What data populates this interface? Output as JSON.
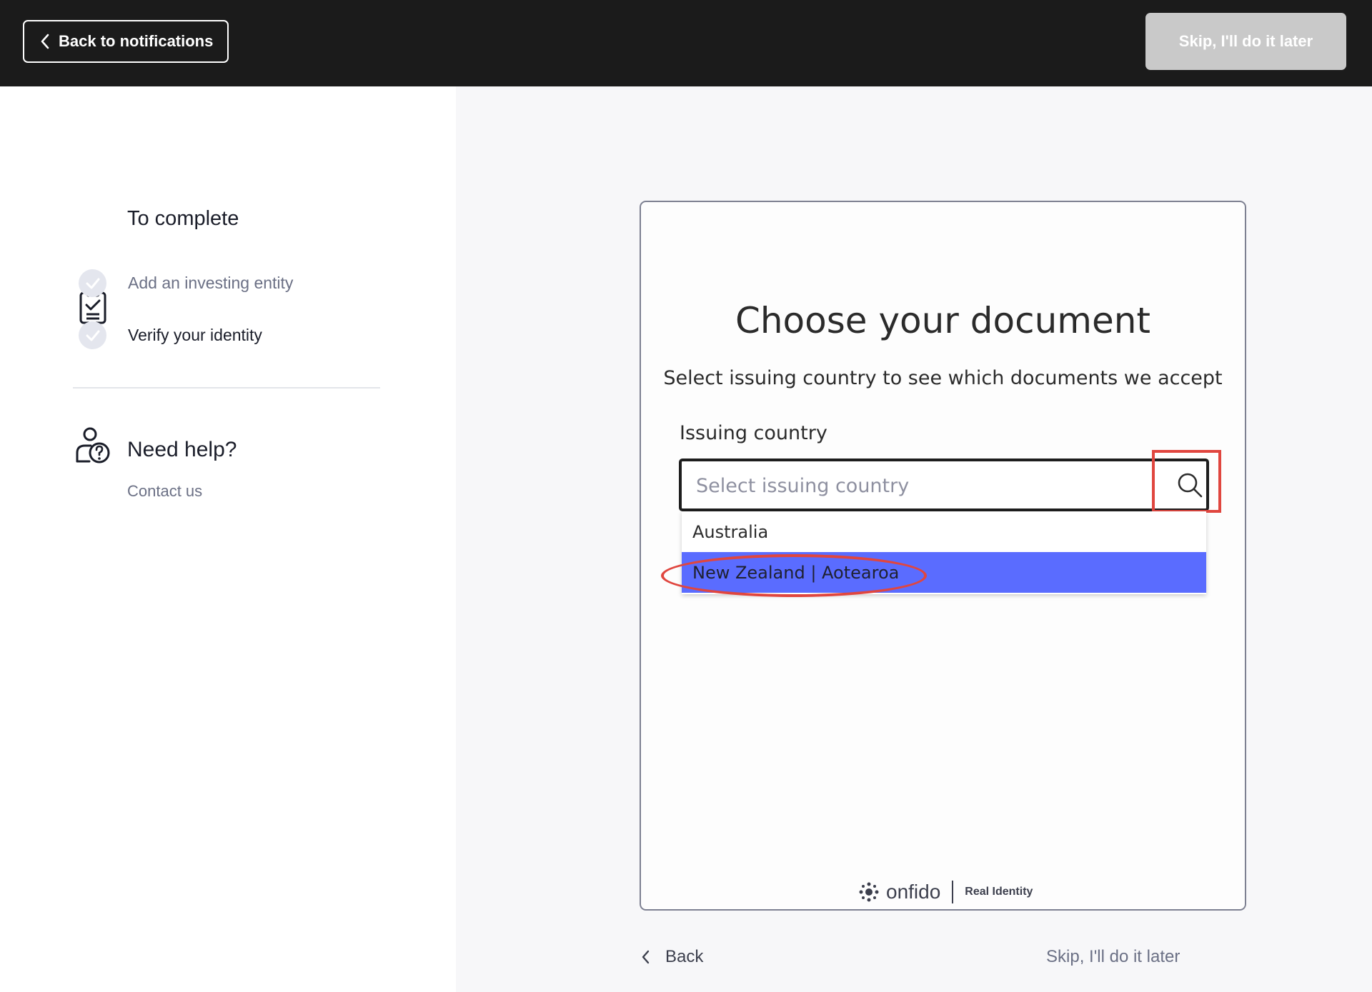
{
  "topbar": {
    "back_label": "Back to notifications",
    "skip_label": "Skip, I'll do it later"
  },
  "sidebar": {
    "todo_title": "To complete",
    "steps": [
      {
        "label": "Add an investing entity"
      },
      {
        "label": "Verify your identity"
      }
    ],
    "help_title": "Need help?",
    "contact_label": "Contact us"
  },
  "card": {
    "title": "Choose your document",
    "subtitle": "Select issuing country to see which documents we accept",
    "field_label": "Issuing country",
    "field_placeholder": "Select issuing country",
    "options": [
      "Australia",
      "New Zealand | Aotearoa"
    ],
    "selected_option": "New Zealand | Aotearoa",
    "brand_name": "onfido",
    "brand_tag": "Real Identity"
  },
  "footer": {
    "back_label": "Back",
    "skip_label": "Skip, I'll do it later"
  },
  "colors": {
    "topbar": "#1b1b1b",
    "accent": "#5a6cff",
    "annotation": "#e0463f"
  }
}
